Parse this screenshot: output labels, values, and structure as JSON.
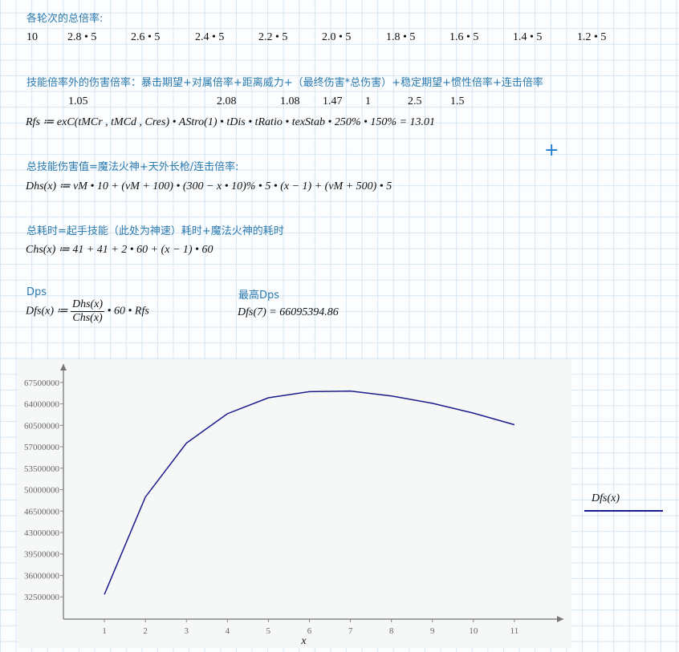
{
  "section1": {
    "title": "各轮次的总倍率:",
    "values": [
      "10",
      "2.8 • 5",
      "2.6 • 5",
      "2.4 • 5",
      "2.2 • 5",
      "2.0 • 5",
      "1.8 • 5",
      "1.6 • 5",
      "1.4 • 5",
      "1.2 • 5"
    ]
  },
  "section2": {
    "title": "技能倍率外的伤害倍率：暴击期望+对属倍率+距离威力+（最终伤害*总伤害）+稳定期望+惯性倍率+连击倍率",
    "values": [
      "1.05",
      "2.08",
      "1.08",
      "1.47",
      "1",
      "2.5",
      "1.5"
    ],
    "formula": "Rfs ≔ exC(tMCr , tMCd , Cres) • AStro(1) • tDis • tRatio • texStab • 250% • 150% = 13.01"
  },
  "section3": {
    "title": "总技能伤害值=魔法火神+天外长枪/连击倍率:",
    "formula": "Dhs(x) ≔ vM • 10 + (vM + 100) • (300 − x • 10)% • 5 • (x − 1) + (vM + 500) • 5"
  },
  "section4": {
    "title": "总耗时=起手技能（此处为神速）耗时+魔法火神的耗时",
    "formula": "Chs(x) ≔ 41 + 41 + 2 • 60 + (x − 1) • 60"
  },
  "section5": {
    "title": "Dps",
    "lhs": "Dfs(x) ≔",
    "num": "Dhs(x)",
    "den": "Chs(x)",
    "rhs": "• 60 • Rfs",
    "max_title": "最高Dps",
    "max_formula": "Dfs(7) = 66095394.86"
  },
  "chart_data": {
    "type": "line",
    "xlabel": "x",
    "legend": "Dfs(x)",
    "legend_position": "right",
    "x": [
      1,
      2,
      3,
      4,
      5,
      6,
      7,
      8,
      9,
      10,
      11
    ],
    "series": [
      {
        "name": "Dfs(x)",
        "color": "#1a1a8c",
        "values": [
          32900000,
          48800000,
          57600000,
          62400000,
          65000000,
          66000000,
          66095395,
          65300000,
          64100000,
          62500000,
          60600000
        ]
      }
    ],
    "xticks": [
      "1",
      "2",
      "3",
      "4",
      "5",
      "6",
      "7",
      "8",
      "9",
      "10",
      "11"
    ],
    "yticks": [
      "32500000",
      "36000000",
      "39500000",
      "43000000",
      "46500000",
      "50000000",
      "53500000",
      "57000000",
      "60500000",
      "64000000",
      "67500000"
    ],
    "xlim": [
      0,
      12
    ],
    "ylim": [
      28860000,
      70500000
    ]
  }
}
